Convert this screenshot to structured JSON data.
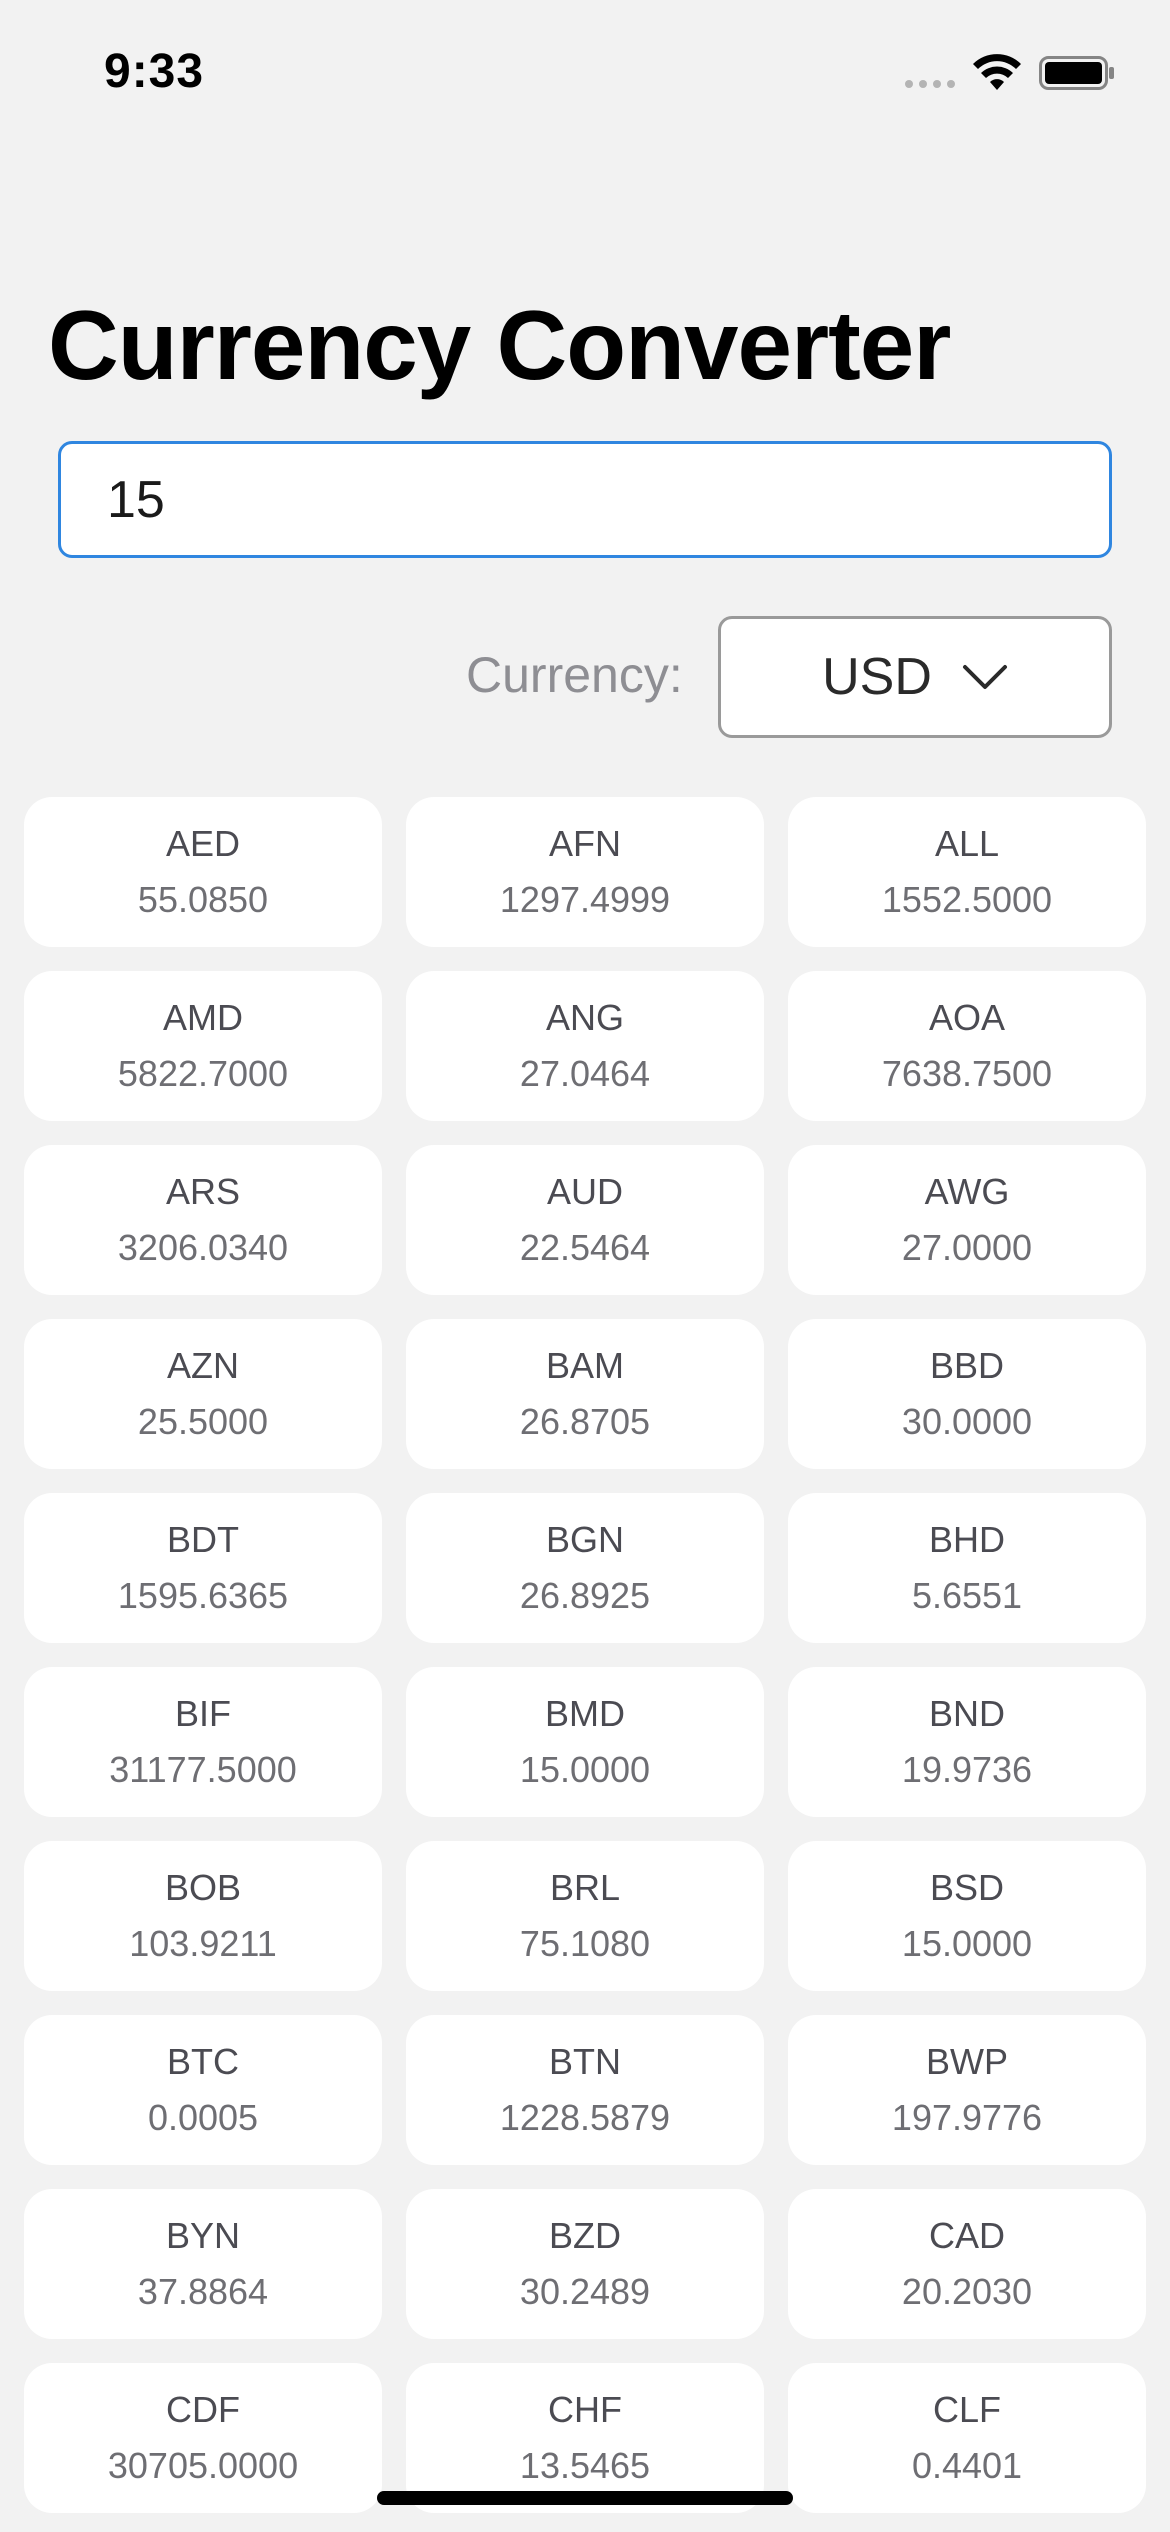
{
  "status_bar": {
    "time": "9:33"
  },
  "app": {
    "title": "Currency Converter"
  },
  "amount_input": {
    "value": "15"
  },
  "currency_selector": {
    "label": "Currency:",
    "selected": "USD"
  },
  "rates": [
    {
      "code": "AED",
      "value": "55.0850"
    },
    {
      "code": "AFN",
      "value": "1297.4999"
    },
    {
      "code": "ALL",
      "value": "1552.5000"
    },
    {
      "code": "AMD",
      "value": "5822.7000"
    },
    {
      "code": "ANG",
      "value": "27.0464"
    },
    {
      "code": "AOA",
      "value": "7638.7500"
    },
    {
      "code": "ARS",
      "value": "3206.0340"
    },
    {
      "code": "AUD",
      "value": "22.5464"
    },
    {
      "code": "AWG",
      "value": "27.0000"
    },
    {
      "code": "AZN",
      "value": "25.5000"
    },
    {
      "code": "BAM",
      "value": "26.8705"
    },
    {
      "code": "BBD",
      "value": "30.0000"
    },
    {
      "code": "BDT",
      "value": "1595.6365"
    },
    {
      "code": "BGN",
      "value": "26.8925"
    },
    {
      "code": "BHD",
      "value": "5.6551"
    },
    {
      "code": "BIF",
      "value": "31177.5000"
    },
    {
      "code": "BMD",
      "value": "15.0000"
    },
    {
      "code": "BND",
      "value": "19.9736"
    },
    {
      "code": "BOB",
      "value": "103.9211"
    },
    {
      "code": "BRL",
      "value": "75.1080"
    },
    {
      "code": "BSD",
      "value": "15.0000"
    },
    {
      "code": "BTC",
      "value": "0.0005"
    },
    {
      "code": "BTN",
      "value": "1228.5879"
    },
    {
      "code": "BWP",
      "value": "197.9776"
    },
    {
      "code": "BYN",
      "value": "37.8864"
    },
    {
      "code": "BZD",
      "value": "30.2489"
    },
    {
      "code": "CAD",
      "value": "20.2030"
    },
    {
      "code": "CDF",
      "value": "30705.0000"
    },
    {
      "code": "CHF",
      "value": "13.5465"
    },
    {
      "code": "CLF",
      "value": "0.4401"
    }
  ],
  "icons": {
    "signal": "cellular-signal-icon",
    "wifi": "wifi-icon",
    "battery": "battery-icon",
    "dropdown": "chevron-down-icon"
  },
  "colors": {
    "background": "#f2f2f2",
    "input_border_focus": "#2f86e0",
    "card_background": "#ffffff",
    "label_gray": "#8e8e93"
  }
}
